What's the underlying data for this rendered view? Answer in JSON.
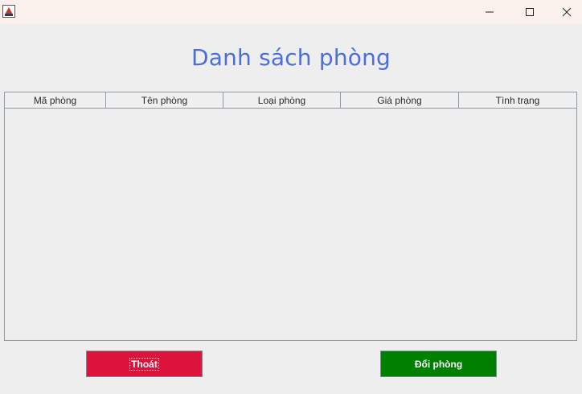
{
  "window": {
    "icons": {
      "app": "java-app-icon",
      "minimize": "minimize-icon",
      "maximize": "maximize-icon",
      "close": "close-icon"
    },
    "titlebar_color": "#fbf1ec"
  },
  "main": {
    "title": "Danh sách phòng",
    "title_color": "#4a6fd9"
  },
  "table": {
    "columns": [
      "Mã phòng",
      "Tên phòng",
      "Loại phòng",
      "Giá phòng",
      "Tình trạng"
    ],
    "rows": []
  },
  "buttons": {
    "exit": {
      "label": "Thoát",
      "color": "#dc143c"
    },
    "change": {
      "label": "Đổi phòng",
      "color": "#008000"
    }
  }
}
